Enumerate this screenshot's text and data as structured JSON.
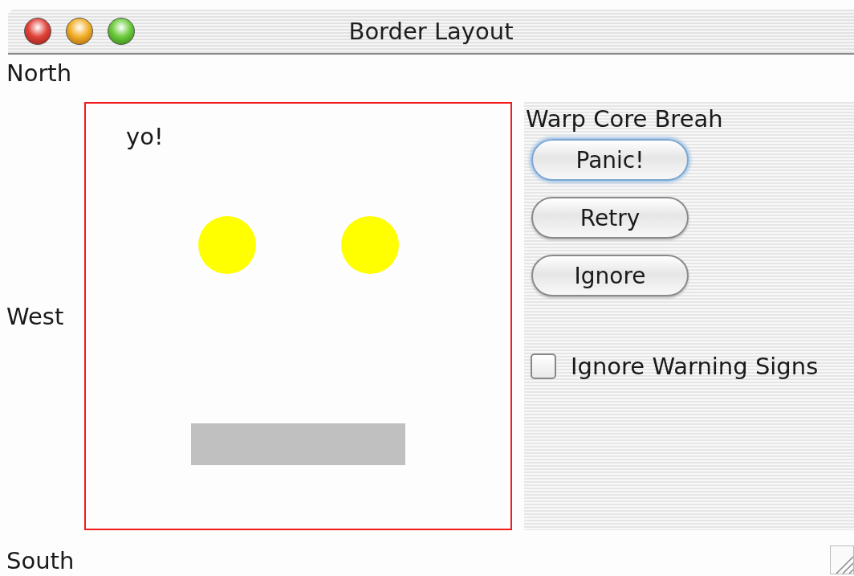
{
  "window": {
    "title": "Border Layout"
  },
  "north": {
    "label": "North"
  },
  "west": {
    "label": "West"
  },
  "center": {
    "text": "yo!"
  },
  "east": {
    "label": "Warp Core Breah",
    "buttons": [
      {
        "label": "Panic!",
        "focused": true
      },
      {
        "label": "Retry",
        "focused": false
      },
      {
        "label": "Ignore",
        "focused": false
      }
    ],
    "checkbox": {
      "label": "Ignore Warning Signs",
      "checked": false
    }
  },
  "south": {
    "label": "South"
  }
}
